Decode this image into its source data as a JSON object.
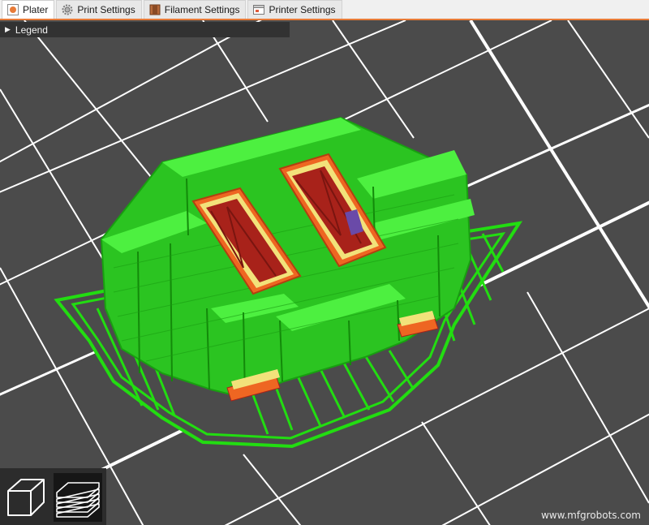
{
  "tabs": [
    {
      "label": "Plater",
      "icon": "plater-icon",
      "active": true
    },
    {
      "label": "Print Settings",
      "icon": "print-settings-gear-icon",
      "active": false
    },
    {
      "label": "Filament Settings",
      "icon": "filament-spool-icon",
      "active": false
    },
    {
      "label": "Printer Settings",
      "icon": "printer-settings-icon",
      "active": false
    }
  ],
  "legend": {
    "label": "Legend",
    "icon": "triangle-right-icon"
  },
  "view_toggles": [
    {
      "name": "3d-view",
      "icon": "cube-icon",
      "active": false
    },
    {
      "name": "layers-preview",
      "icon": "layers-stack-icon",
      "active": true
    }
  ],
  "watermark": "www.mfgrobots.com",
  "colors": {
    "accent": "#e87b38",
    "bed": "#4b4b4b",
    "grid": "#ffffff",
    "support": "#22dd11",
    "perimeter_outer": "#ee6622",
    "infill": "#a8221a",
    "perimeter_inner": "#f2e27a"
  }
}
